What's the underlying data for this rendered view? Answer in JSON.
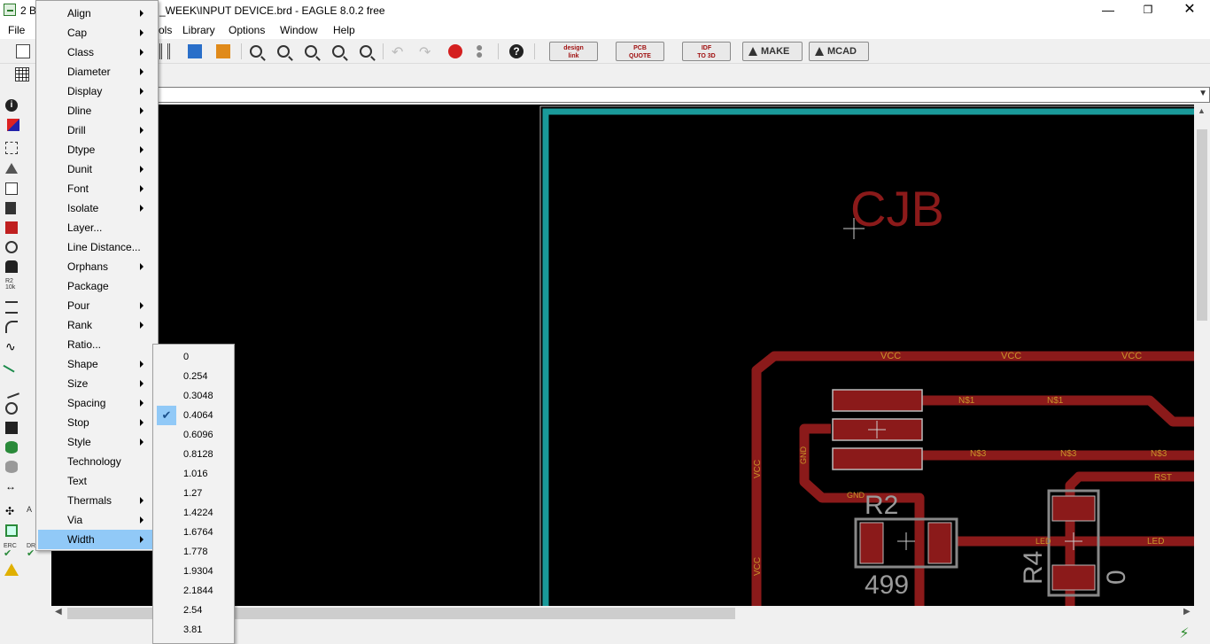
{
  "window": {
    "title_prefix": "2 B",
    "title_suffix": "_WEEK\\INPUT DEVICE.brd - EAGLE 8.0.2 free",
    "controls": {
      "minimize": "—",
      "maximize": "❐",
      "close": "✕"
    }
  },
  "menubar": {
    "items": [
      "File",
      "ols",
      "Library",
      "Options",
      "Window",
      "Help"
    ]
  },
  "toolbar": {
    "design_link": [
      "design",
      "link"
    ],
    "pcb_quote": [
      "PCB",
      "QUOTE"
    ],
    "idf_to_3d": [
      "IDF",
      "TO 3D"
    ],
    "make": "MAKE",
    "mcad": "MCAD"
  },
  "context_menu": {
    "items": [
      {
        "label": "Align",
        "submenu": true
      },
      {
        "label": "Cap",
        "submenu": true
      },
      {
        "label": "Class",
        "submenu": true
      },
      {
        "label": "Diameter",
        "submenu": true
      },
      {
        "label": "Display",
        "submenu": true
      },
      {
        "label": "Dline",
        "submenu": true
      },
      {
        "label": "Drill",
        "submenu": true
      },
      {
        "label": "Dtype",
        "submenu": true
      },
      {
        "label": "Dunit",
        "submenu": true
      },
      {
        "label": "Font",
        "submenu": true
      },
      {
        "label": "Isolate",
        "submenu": true
      },
      {
        "label": "Layer...",
        "submenu": false
      },
      {
        "label": "Line Distance...",
        "submenu": false
      },
      {
        "label": "Orphans",
        "submenu": true
      },
      {
        "label": "Package",
        "submenu": false
      },
      {
        "label": "Pour",
        "submenu": true
      },
      {
        "label": "Rank",
        "submenu": true
      },
      {
        "label": "Ratio...",
        "submenu": false
      },
      {
        "label": "Shape",
        "submenu": true
      },
      {
        "label": "Size",
        "submenu": true
      },
      {
        "label": "Spacing",
        "submenu": true
      },
      {
        "label": "Stop",
        "submenu": true
      },
      {
        "label": "Style",
        "submenu": true
      },
      {
        "label": "Technology",
        "submenu": false
      },
      {
        "label": "Text",
        "submenu": false
      },
      {
        "label": "Thermals",
        "submenu": true
      },
      {
        "label": "Via",
        "submenu": true
      },
      {
        "label": "Width",
        "submenu": true
      }
    ],
    "active": "Width"
  },
  "width_submenu": {
    "items": [
      "0",
      "0.254",
      "0.3048",
      "0.4064",
      "0.6096",
      "0.8128",
      "1.016",
      "1.27",
      "1.4224",
      "1.6764",
      "1.778",
      "1.9304",
      "2.1844",
      "2.54",
      "3.81"
    ],
    "checked": "0.4064"
  },
  "board": {
    "title_text": "CJB",
    "net_labels": {
      "vcc": "VCC",
      "n1": "N$1",
      "n3": "N$3",
      "gnd": "GND",
      "rst": "RST",
      "led": "LED"
    },
    "part_r2": {
      "name": "R2",
      "value": "499"
    },
    "part_r4": {
      "name": "R4",
      "value": "0"
    },
    "colors": {
      "trace": "#8b1a1a",
      "outline": "#1a9a9a",
      "background": "#000000"
    }
  },
  "left_tool_labels": {
    "erc": "ERC",
    "drc": "DR",
    "r2": "R2",
    "r2_sub": "10k",
    "a": "A"
  },
  "cmdline": {
    "dropdown": "▼"
  },
  "status": {
    "go": "⚡"
  }
}
